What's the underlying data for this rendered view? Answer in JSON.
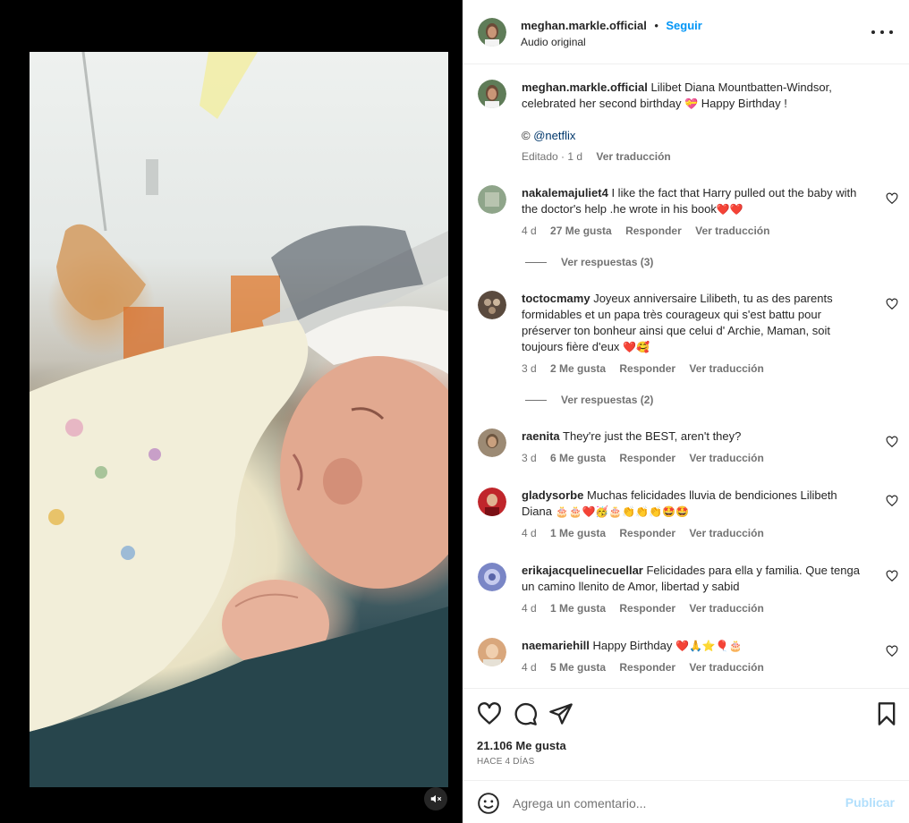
{
  "post": {
    "username": "meghan.markle.official",
    "follow_label": "Seguir",
    "audio": "Audio original",
    "more_icon": "more-options-icon",
    "separator": "•"
  },
  "caption": {
    "username": "meghan.markle.official",
    "text": "Lilibet Diana Mountbatten-Windsor, celebrated her second birthday",
    "text_after": "Happy Birthday !",
    "heart_emoji": "💝",
    "copyright": "©",
    "mention": "@netflix",
    "edited": "Editado · 1 d",
    "translate": "Ver traducción"
  },
  "comments": [
    {
      "username": "nakalemajuliet4",
      "text": "I like the fact that Harry pulled out the baby with the doctor's help .he wrote in his book",
      "emoji": "❤️❤️",
      "age": "4 d",
      "likes": "27 Me gusta",
      "reply": "Responder",
      "translate": "Ver traducción",
      "view_replies": "Ver respuestas (3)",
      "avatar_color": "#8fa58a"
    },
    {
      "username": "toctocmamy",
      "text": "Joyeux anniversaire Lilibeth, tu as des parents formidables et un papa très courageux qui s'est battu pour préserver ton bonheur ainsi que celui d' Archie, Maman, soit toujours fière d'eux",
      "emoji": "❤️🥰",
      "age": "3 d",
      "likes": "2 Me gusta",
      "reply": "Responder",
      "translate": "Ver traducción",
      "view_replies": "Ver respuestas (2)",
      "avatar_color": "#5a4a3e"
    },
    {
      "username": "raenita",
      "text": "They're just the BEST, aren't they?",
      "emoji": "",
      "age": "3 d",
      "likes": "6 Me gusta",
      "reply": "Responder",
      "translate": "Ver traducción",
      "view_replies": "",
      "avatar_color": "#9c8a74"
    },
    {
      "username": "gladysorbe",
      "text": "Muchas felicidades lluvia de bendiciones Lilibeth Diana",
      "emoji": "🎂🎂❤️🥳🎂👏👏👏🤩🤩",
      "age": "4 d",
      "likes": "1 Me gusta",
      "reply": "Responder",
      "translate": "Ver traducción",
      "view_replies": "",
      "avatar_color": "#c0262b"
    },
    {
      "username": "erikajacquelinecuellar",
      "text": "Felicidades para ella y familia. Que tenga un camino llenito de Amor, libertad y sabid",
      "emoji": "",
      "age": "4 d",
      "likes": "1 Me gusta",
      "reply": "Responder",
      "translate": "Ver traducción",
      "view_replies": "",
      "avatar_color": "#7a86c6"
    },
    {
      "username": "naemariehill",
      "text": "Happy Birthday",
      "emoji": "❤️🙏⭐🎈🎂",
      "age": "4 d",
      "likes": "5 Me gusta",
      "reply": "Responder",
      "translate": "Ver traducción",
      "view_replies": "",
      "avatar_color": "#d9a77c"
    }
  ],
  "actions": {
    "like_icon": "heart-icon",
    "comment_icon": "comment-icon",
    "share_icon": "share-icon",
    "save_icon": "bookmark-icon",
    "likes_count": "21.106 Me gusta",
    "time_ago": "HACE 4 DÍAS"
  },
  "add_comment": {
    "placeholder": "Agrega un comentario...",
    "publish_label": "Publicar",
    "emoji_icon": "smiley-icon"
  },
  "media": {
    "mute_icon": "muted-speaker-icon"
  },
  "colors": {
    "link_blue": "#0095f6",
    "publish_disabled": "#b2dffc",
    "secondary_text": "#737373",
    "primary_text": "#262626"
  }
}
